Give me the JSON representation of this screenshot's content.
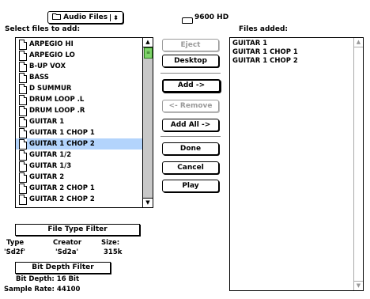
{
  "folder_popup": {
    "label": "Audio Files",
    "icon": "folder-icon",
    "arrows": "⬍"
  },
  "disk": {
    "icon": "hard-disk-icon",
    "name": "9600 HD"
  },
  "left_pane": {
    "heading": "Select files to add:",
    "files": [
      "ARPEGIO HI",
      "ARPEGIO LO",
      "B-UP VOX",
      "BASS",
      "D SUMMUR",
      "DRUM LOOP .L",
      "DRUM LOOP .R",
      "GUITAR 1",
      "GUITAR 1 CHOP 1",
      "GUITAR 1 CHOP 2",
      "GUITAR 1/2",
      "GUITAR 1/3",
      "GUITAR 2",
      "GUITAR 2 CHOP 1",
      "GUITAR 2 CHOP 2"
    ],
    "selected": "GUITAR 1 CHOP 2"
  },
  "buttons": {
    "eject": "Eject",
    "desktop": "Desktop",
    "add": "Add ->",
    "remove": "<- Remove",
    "add_all": "Add All ->",
    "done": "Done",
    "cancel": "Cancel",
    "play": "Play"
  },
  "right_pane": {
    "heading": "Files added:",
    "files": [
      "GUITAR 1",
      "GUITAR 1 CHOP 1",
      "GUITAR 1 CHOP 2"
    ]
  },
  "file_type_filter": {
    "title": "File Type Filter",
    "type_label": "Type",
    "creator_label": "Creator",
    "size_label": "Size:",
    "type_value": "'Sd2f'",
    "creator_value": "'Sd2a'",
    "size_value": "315k"
  },
  "bit_depth_filter": {
    "title": "Bit Depth Filter",
    "bit_depth": "Bit Depth: 16 Bit",
    "sample_rate": "Sample Rate: 44100"
  },
  "scroll_arrows": {
    "up": "▲",
    "down": "▼",
    "thumb_grip": "≡"
  }
}
